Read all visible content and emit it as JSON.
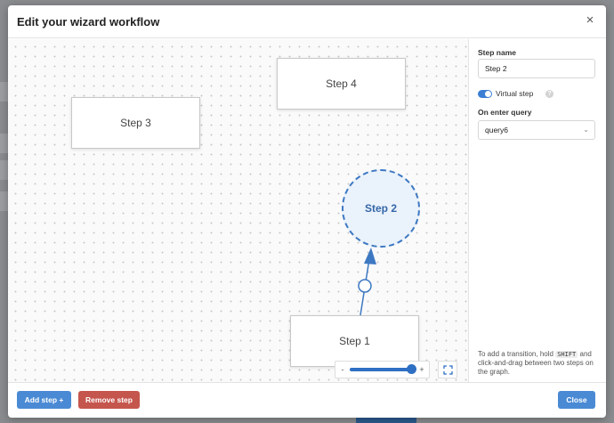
{
  "modal": {
    "title": "Edit your wizard workflow",
    "close_glyph": "×"
  },
  "graph": {
    "steps": [
      {
        "label": "Step 3"
      },
      {
        "label": "Step 4"
      },
      {
        "label": "Step 1"
      }
    ],
    "virtual_step": {
      "label": "Step 2"
    },
    "zoom": {
      "minus": "-",
      "plus": "+",
      "level": 1.0
    }
  },
  "panel": {
    "step_name_label": "Step name",
    "step_name_value": "Step 2",
    "virtual_step_label": "Virtual step",
    "virtual_step_enabled": true,
    "help_glyph": "?",
    "on_enter_label": "On enter query",
    "on_enter_value": "query6",
    "help_text_before": "To add a transition, hold",
    "help_text_key": "SHIFT",
    "help_text_after": "and click-and-drag between two steps on the graph."
  },
  "footer": {
    "add_step": "Add step +",
    "remove_step": "Remove step",
    "close": "Close"
  },
  "colors": {
    "primary": "#4a8ad4",
    "danger": "#c5564d",
    "virtual_border": "#3d78c2"
  }
}
